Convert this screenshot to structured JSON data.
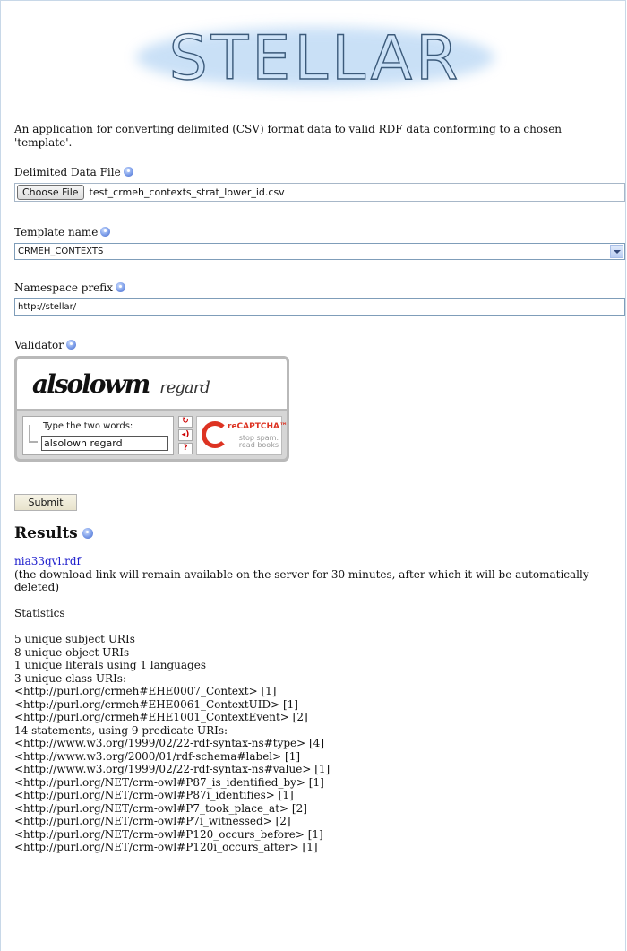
{
  "logo": {
    "text": "STELLAR"
  },
  "description": "An application for converting delimited (CSV) format data to valid RDF data conforming to a chosen 'template'.",
  "fields": {
    "file": {
      "label": "Delimited Data File",
      "button_label": "Choose File",
      "file_name": "test_crmeh_contexts_strat_lower_id.csv"
    },
    "template": {
      "label": "Template name",
      "selected": "CRMEH_CONTEXTS"
    },
    "namespace": {
      "label": "Namespace prefix",
      "value": "http://stellar/"
    },
    "validator": {
      "label": "Validator",
      "captcha_word1": "alsolowm",
      "captcha_word2": "regard",
      "prompt": "Type the two words:",
      "input_value": "alsolown regard",
      "brand": "reCAPTCHA™",
      "tagline1": "stop spam.",
      "tagline2": "read books"
    }
  },
  "submit_label": "Submit",
  "results": {
    "heading": "Results",
    "download_link": "nia33qvl.rdf",
    "download_note": "(the download link will remain available on the server for 30 minutes, after which it will be automatically deleted)",
    "separator": "----------",
    "stats_heading": "Statistics",
    "lines": [
      "5 unique subject URIs",
      "8 unique object URIs",
      "1 unique literals using 1 languages",
      "3 unique class URIs:",
      "<http://purl.org/crmeh#EHE0007_Context> [1]",
      "<http://purl.org/crmeh#EHE0061_ContextUID> [1]",
      "<http://purl.org/crmeh#EHE1001_ContextEvent> [2]",
      "14 statements, using 9 predicate URIs:",
      "<http://www.w3.org/1999/02/22-rdf-syntax-ns#type> [4]",
      "<http://www.w3.org/2000/01/rdf-schema#label> [1]",
      "<http://www.w3.org/1999/02/22-rdf-syntax-ns#value> [1]",
      "<http://purl.org/NET/crm-owl#P87_is_identified_by> [1]",
      "<http://purl.org/NET/crm-owl#P87i_identifies> [1]",
      "<http://purl.org/NET/crm-owl#P7_took_place_at> [2]",
      "<http://purl.org/NET/crm-owl#P7i_witnessed> [2]",
      "<http://purl.org/NET/crm-owl#P120_occurs_before> [1]",
      "<http://purl.org/NET/crm-owl#P120i_occurs_after> [1]"
    ]
  }
}
